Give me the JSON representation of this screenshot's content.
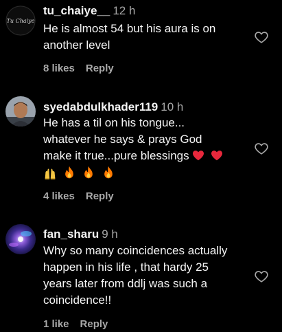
{
  "comments": [
    {
      "username": "tu_chaiye__",
      "time": "12 h",
      "avatar_text": "Tu Chaiye",
      "avatar_icon": "tu-chaiye-logo-avatar",
      "lines": [
        "He is almost 54 but his aura is on",
        "another level"
      ],
      "likes": "8 likes",
      "reply": "Reply"
    },
    {
      "username": "syedabdulkhader119",
      "time": "10 h",
      "avatar_icon": "user-photo-avatar",
      "lines": [
        "He has a til on his tongue...",
        "whatever he says & prays God",
        "make it true...pure blessings"
      ],
      "emoji_line1": [
        "red-heart-icon",
        "red-heart-icon"
      ],
      "emoji_line2": [
        "raised-hands-icon",
        "fire-icon",
        "fire-icon",
        "fire-icon"
      ],
      "likes": "4 likes",
      "reply": "Reply"
    },
    {
      "username": "fan_sharu",
      "time": "9 h",
      "avatar_icon": "galaxy-avatar",
      "lines": [
        "Why so many coincidences actually",
        "happen in his life , that hardy 25",
        "years later from ddlj was such a",
        "coincidence!!"
      ],
      "likes": "1 like",
      "reply": "Reply"
    }
  ],
  "colors": {
    "background": "#000000",
    "text": "#f5f5f5",
    "secondary": "#a8a8a8",
    "heart": "#e8283c",
    "fire": "#ff7a00"
  }
}
